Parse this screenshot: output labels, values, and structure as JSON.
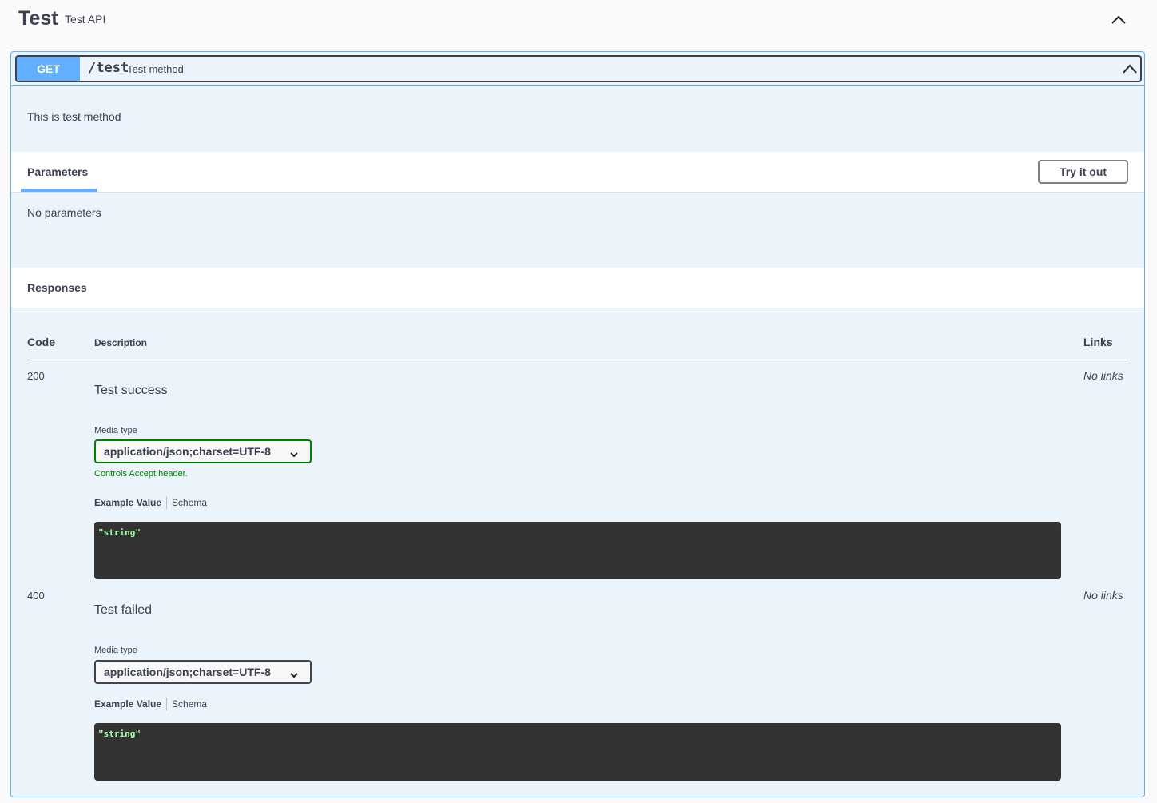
{
  "tag": {
    "title": "Test",
    "description": "Test API"
  },
  "operation": {
    "method": "GET",
    "path": "/test",
    "summary": "Test method",
    "description": "This is test method",
    "method_color": "#61affe"
  },
  "parameters": {
    "tab_label": "Parameters",
    "try_label": "Try it out",
    "empty_text": "No parameters"
  },
  "responses": {
    "title": "Responses",
    "columns": {
      "code": "Code",
      "description": "Description",
      "links": "Links"
    },
    "items": [
      {
        "code": "200",
        "description": "Test success",
        "links": "No links",
        "media_label": "Media type",
        "media_value": "application/json;charset=UTF-8",
        "controls_note": "Controls Accept header.",
        "example_tab": "Example Value",
        "schema_tab": "Schema",
        "example": "\"string\""
      },
      {
        "code": "400",
        "description": "Test failed",
        "links": "No links",
        "media_label": "Media type",
        "media_value": "application/json;charset=UTF-8",
        "example_tab": "Example Value",
        "schema_tab": "Schema",
        "example": "\"string\""
      }
    ]
  },
  "icons": {
    "tag_toggle": "chevron-up-icon",
    "summary_toggle": "chevron-up-icon",
    "select_arrow": "chevron-down-icon"
  }
}
